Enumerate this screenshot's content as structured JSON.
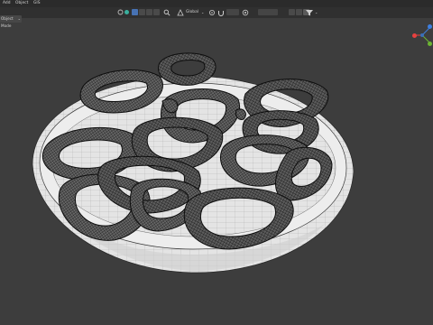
{
  "menubar": {
    "items": [
      "Add",
      "Object",
      "GIS"
    ]
  },
  "header": {
    "mode": "Object Mode",
    "transform_orientation": "Global"
  },
  "colors": {
    "background": "#3d3d3d",
    "bowl_fill": "#e6e6e6",
    "wire": "#121212",
    "axis_x": "#e8413f",
    "axis_y": "#6cb533",
    "axis_z": "#3d7fe0",
    "active_tool": "#4772b3"
  },
  "icons": [
    "cursor-icon",
    "move-icon",
    "rotate-icon",
    "scale-icon",
    "search-icon",
    "snap-icon",
    "proportional-edit-icon",
    "overlay-icon",
    "shading-icon",
    "filter-icon",
    "axis-gizmo"
  ]
}
